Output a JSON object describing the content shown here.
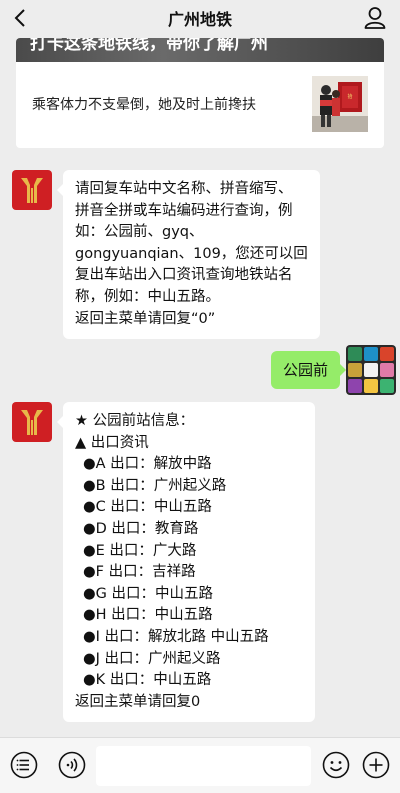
{
  "header": {
    "title": "广州地铁",
    "back_icon": "chevron-left-icon",
    "profile_icon": "user-icon"
  },
  "article": {
    "banner_text": "打卡这条地铁线，带你了解广州",
    "title": "乘客体力不支晕倒，她及时上前搀扶"
  },
  "messages": {
    "bot1": {
      "lines": [
        "请回复车站中文名称、拼音缩写、",
        "拼音全拼或车站编码进行查询，例",
        "如：公园前、gyq、",
        "gongyuanqian、109，您还可以回",
        "复出车站出入口资讯查询地铁站名",
        "称，例如：中山五路。",
        "返回主菜单请回复“0”"
      ]
    },
    "user1": {
      "text": "公园前"
    },
    "bot2": {
      "title": "★ 公园前站信息：",
      "section": "▲ 出口资讯",
      "exits": [
        "●A 出口：解放中路",
        "●B 出口：广州起义路",
        "●C 出口：中山五路",
        "●D 出口：教育路",
        "●E 出口：广大路",
        "●F 出口：吉祥路",
        "●G 出口：中山五路",
        "●H 出口：中山五路",
        "●I 出口：解放北路  中山五路",
        "●J 出口：广州起义路",
        "●K 出口：中山五路"
      ],
      "footer": "返回主菜单请回复0"
    }
  },
  "bottombar": {
    "menu_icon": "menu-list-icon",
    "voice_icon": "voice-icon",
    "input_value": "",
    "emoji_icon": "emoji-icon",
    "add_icon": "plus-circle-icon"
  },
  "colors": {
    "brand_red": "#cf1f23",
    "brand_gold": "#e8b84a",
    "bubble_green": "#95ec69",
    "background": "#ededed"
  }
}
